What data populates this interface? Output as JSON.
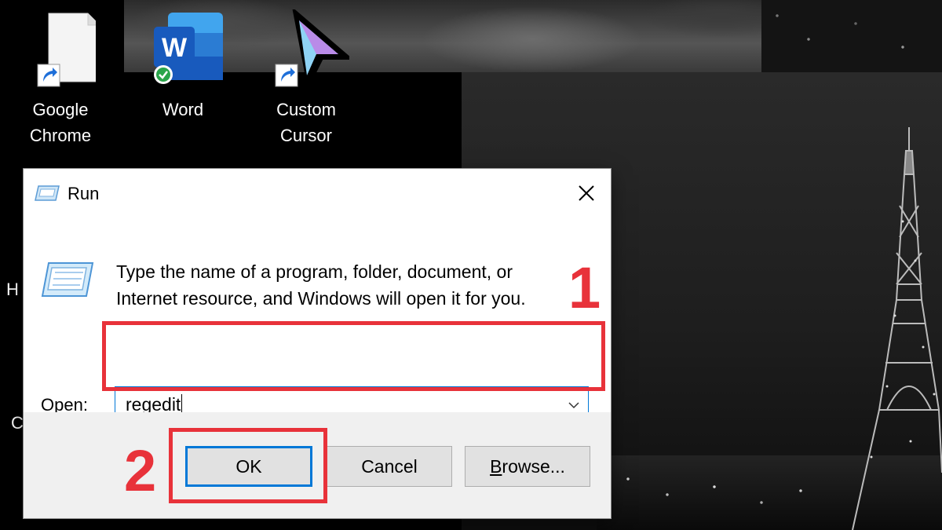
{
  "desktop": {
    "icons": [
      {
        "label_line1": "Google",
        "label_line2": "Chrome"
      },
      {
        "label_line1": "Word",
        "label_line2": ""
      },
      {
        "label_line1": "Custom",
        "label_line2": "Cursor"
      }
    ],
    "partial_letters": [
      "H",
      "C"
    ]
  },
  "run_dialog": {
    "title": "Run",
    "description_line1": "Type the name of a program, folder, document, or",
    "description_line2": "Internet resource, and Windows will open it for you.",
    "open_label_accesskey": "O",
    "open_label_rest": "pen:",
    "open_value": "regedit",
    "buttons": {
      "ok": "OK",
      "cancel": "Cancel",
      "browse_accesskey": "B",
      "browse_rest": "rowse..."
    }
  },
  "annotations": {
    "step1": "1",
    "step2": "2",
    "color": "#e8323a"
  },
  "icons": [
    "file-icon",
    "shortcut-arrow-icon",
    "word-icon",
    "sync-check-icon",
    "cursor-icon",
    "run-icon",
    "close-icon",
    "chevron-down-icon"
  ],
  "colors": {
    "accent": "#0078d7",
    "word_blue": "#185abd",
    "button_face": "#e1e1e1",
    "dialog_footer": "#f0f0f0"
  }
}
